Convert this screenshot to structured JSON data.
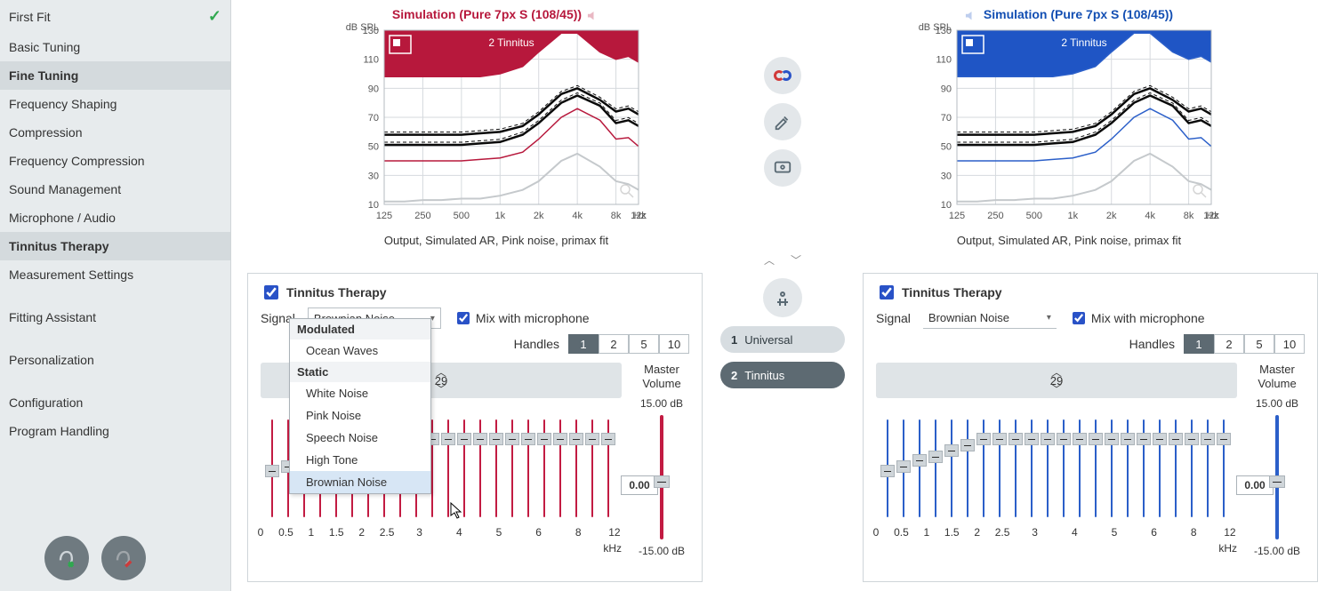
{
  "sidebar": {
    "items": [
      {
        "label": "First Fit",
        "checked": true
      },
      {
        "label": "Basic Tuning"
      },
      {
        "label": "Fine Tuning",
        "bold": true
      },
      {
        "label": "Frequency Shaping"
      },
      {
        "label": "Compression"
      },
      {
        "label": "Frequency Compression"
      },
      {
        "label": "Sound Management"
      },
      {
        "label": "Microphone / Audio"
      },
      {
        "label": "Tinnitus Therapy",
        "active": true
      },
      {
        "label": "Measurement Settings"
      },
      {
        "label": "Fitting Assistant"
      },
      {
        "label": "Personalization"
      },
      {
        "label": "Configuration"
      },
      {
        "label": "Program Handling"
      }
    ]
  },
  "charts": {
    "left_title": "Simulation (Pure 7px S (108/45))",
    "right_title": "Simulation (Pure 7px S (108/45))",
    "ylabel": "dB SPL",
    "badge": "2 Tinnitus",
    "caption": "Output, Simulated AR, Pink noise, primax fit",
    "xunit": "Hz"
  },
  "chart_data": {
    "type": "line",
    "ylabel": "dB SPL",
    "ylim": [
      10,
      130
    ],
    "yticks": [
      10,
      30,
      50,
      70,
      90,
      110,
      130
    ],
    "xticks_labels": [
      "125",
      "250",
      "500",
      "1k",
      "2k",
      "4k",
      "8k",
      "12k"
    ],
    "xticks_values": [
      125,
      250,
      500,
      1000,
      2000,
      4000,
      8000,
      12000
    ],
    "x": [
      125,
      180,
      250,
      350,
      500,
      700,
      1000,
      1500,
      2000,
      3000,
      4000,
      6000,
      8000,
      10000,
      12000
    ],
    "series": [
      {
        "name": "MPO",
        "values": [
          98,
          98,
          98,
          98,
          98,
          98,
          100,
          105,
          115,
          128,
          128,
          115,
          110,
          112,
          108
        ]
      },
      {
        "name": "G80",
        "values": [
          58,
          58,
          58,
          58,
          58,
          59,
          60,
          64,
          72,
          86,
          90,
          82,
          74,
          76,
          72
        ]
      },
      {
        "name": "G65",
        "values": [
          51,
          51,
          51,
          51,
          51,
          52,
          53,
          58,
          66,
          80,
          85,
          78,
          66,
          68,
          64
        ]
      },
      {
        "name": "G50",
        "values": [
          40,
          40,
          40,
          40,
          40,
          41,
          42,
          46,
          55,
          70,
          76,
          68,
          55,
          56,
          50
        ]
      },
      {
        "name": "Loss/thr",
        "values": [
          12,
          12,
          13,
          13,
          14,
          14,
          16,
          20,
          26,
          40,
          45,
          36,
          26,
          24,
          20
        ]
      }
    ],
    "series_colors": [
      "#b7183c",
      "#0a0a0a",
      "#0a0a0a",
      "#b7183c",
      "#c5c9cc"
    ],
    "series_colors_right": [
      "#2b5fc9",
      "#0a0a0a",
      "#0a0a0a",
      "#2b5fc9",
      "#c5c9cc"
    ]
  },
  "panel": {
    "title": "Tinnitus Therapy",
    "signal_label": "Signal",
    "signal_value": "Brownian Noise",
    "mix_label": "Mix with microphone",
    "handles_label": "Handles",
    "handle_options": [
      "1",
      "2",
      "5",
      "10"
    ],
    "handle_active": "1",
    "gain_value": "29",
    "master_label_top": "Master",
    "master_label_bottom": "Volume",
    "master_max": "15.00 dB",
    "master_min": "-15.00 dB",
    "master_value": "0.00",
    "xticks": [
      "0",
      "0.5",
      "1",
      "1.5",
      "2",
      "2.5",
      "3",
      "4",
      "5",
      "6",
      "8",
      "12"
    ],
    "xunit": "kHz"
  },
  "signal_menu": {
    "group1": "Modulated",
    "items1": [
      "Ocean Waves"
    ],
    "group2": "Static",
    "items2": [
      "White Noise",
      "Pink Noise",
      "Speech Noise",
      "High Tone",
      "Brownian Noise"
    ]
  },
  "programs": {
    "p1_num": "1",
    "p1_label": "Universal",
    "p2_num": "2",
    "p2_label": "Tinnitus"
  },
  "slider_heights": [
    0.17,
    0.22,
    0.28,
    0.32,
    0.38,
    0.44,
    0.5,
    0.5,
    0.5,
    0.5,
    0.5,
    0.5,
    0.5,
    0.5,
    0.5,
    0.5,
    0.5,
    0.5,
    0.5,
    0.5,
    0.5,
    0.5
  ]
}
